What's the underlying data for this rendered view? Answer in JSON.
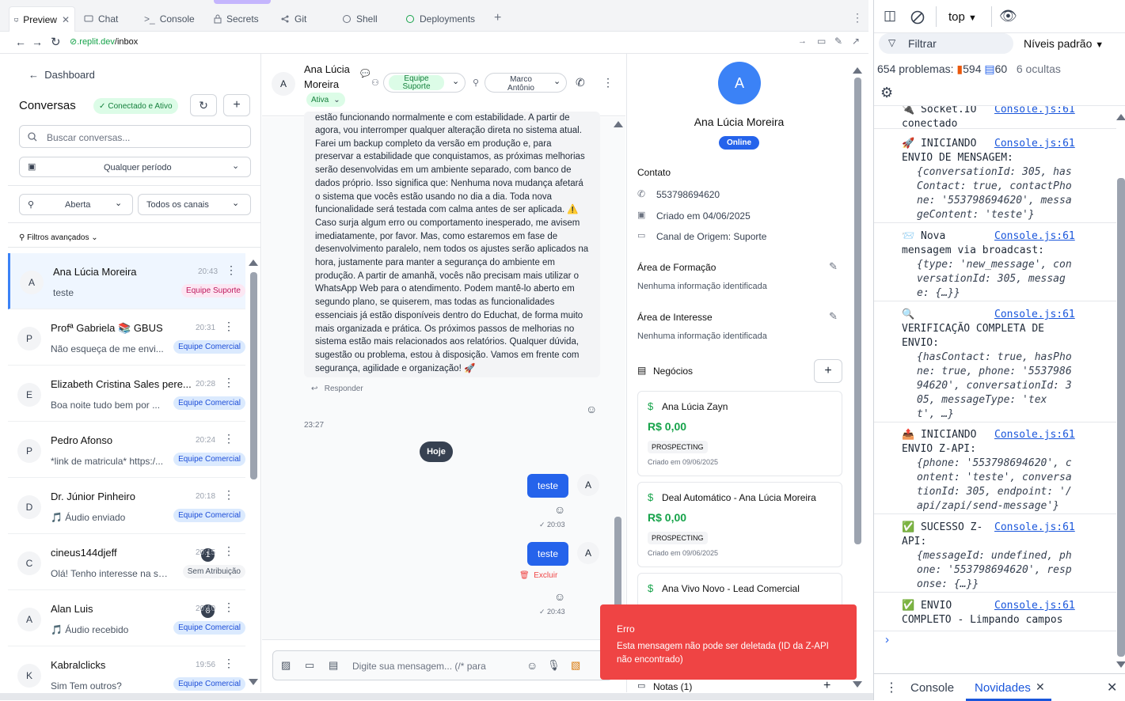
{
  "tabs": [
    {
      "label": "Preview"
    },
    {
      "label": "Chat"
    },
    {
      "label": "Console"
    },
    {
      "label": "Secrets"
    },
    {
      "label": "Git"
    },
    {
      "label": "Shell"
    },
    {
      "label": "Deployments"
    }
  ],
  "url": {
    "domain": ".replit.dev",
    "path": "/inbox"
  },
  "left": {
    "back": "Dashboard",
    "title": "Conversas",
    "status": "Conectado e Ativo",
    "search_placeholder": "Buscar conversas...",
    "period": "Qualquer período",
    "status_filter": "Aberta",
    "channel_filter": "Todos os canais",
    "advanced": "Filtros avançados",
    "conversations": [
      {
        "initial": "A",
        "name": "Ana Lúcia Moreira",
        "time": "20:43",
        "msg": "teste",
        "badge": "Equipe Suporte",
        "badge_color": "pink"
      },
      {
        "initial": "P",
        "name": "Profª Gabriela 📚 GBUS",
        "time": "20:31",
        "msg": "Não esqueça de me envi...",
        "badge": "Equipe Comercial",
        "badge_color": "blue"
      },
      {
        "initial": "E",
        "name": "Elizabeth Cristina Sales pere...",
        "time": "20:28",
        "msg": "Boa noite tudo bem por ...",
        "badge": "Equipe Comercial",
        "badge_color": "blue"
      },
      {
        "initial": "P",
        "name": "Pedro Afonso",
        "time": "20:24",
        "msg": "*link de matricula* https:/...",
        "badge": "Equipe Comercial",
        "badge_color": "blue"
      },
      {
        "initial": "D",
        "name": "Dr. Júnior Pinheiro",
        "time": "20:18",
        "msg": "🎵 Áudio enviado",
        "badge": "Equipe Comercial",
        "badge_color": "blue"
      },
      {
        "initial": "C",
        "name": "cineus144djeff",
        "time": "20:15",
        "msg": "Olá! Tenho interesse na seg...",
        "badge": "Sem Atribuição",
        "badge_color": "gray",
        "unread": "1"
      },
      {
        "initial": "A",
        "name": "Alan Luis",
        "time": "20:10",
        "msg": "🎵 Áudio recebido",
        "badge": "Equipe Comercial",
        "badge_color": "blue",
        "unread": "8"
      },
      {
        "initial": "K",
        "name": "Kabralclicks",
        "time": "19:56",
        "msg": "Sim Tem outros?",
        "badge": "Equipe Comercial",
        "badge_color": "blue"
      }
    ]
  },
  "chat": {
    "avatar": "A",
    "name_line1": "Ana Lúcia",
    "name_line2": "Moreira",
    "status": "Ativa",
    "team": "Equipe Suporte",
    "agent": "Marco Antônio",
    "message_top": "estão funcionando normalmente e com estabilidade. A partir de",
    "message_body": "agora, vou interromper qualquer alteração direta no sistema atual. Farei um backup completo da versão em produção e, para preservar a estabilidade que conquistamos, as próximas melhorias serão desenvolvidas em um ambiente separado, com banco de dados próprio. Isso significa que: Nenhuma nova mudança afetará o sistema que vocês estão usando no dia a dia. Toda nova funcionalidade será testada com calma antes de ser aplicada. ⚠️ Caso surja algum erro ou comportamento inesperado, me avisem imediatamente, por favor. Mas, como estaremos em fase de desenvolvimento paralelo, nem todos os ajustes serão aplicados na hora, justamente para manter a segurança do ambiente em produção. A partir de amanhã, vocês não precisam mais utilizar o WhatsApp Web para o atendimento. Podem mantê-lo aberto em segundo plano, se quiserem, mas todas as funcionalidades essenciais já estão disponíveis dentro do Educhat, de forma muito mais organizada e prática. Os próximos passos de melhorias no sistema estão mais relacionados aos relatórios. Qualquer dúvida, sugestão ou problema, estou à disposição. Vamos em frente com segurança, agilidade e organização! 🚀",
    "reply": "Responder",
    "time_in": "23:27",
    "day": "Hoje",
    "out1": {
      "text": "teste",
      "time": "20:03"
    },
    "out2": {
      "text": "teste",
      "time": "20:43",
      "delete": "Excluir"
    },
    "input_placeholder": "Digite sua mensagem... (/* para"
  },
  "info": {
    "avatar": "A",
    "name": "Ana Lúcia Moreira",
    "online": "Online",
    "contact_title": "Contato",
    "phone": "553798694620",
    "created": "Criado em 04/06/2025",
    "channel": "Canal de Origem: Suporte",
    "formacao_title": "Área de Formação",
    "formacao_value": "Nenhuma informação identificada",
    "interesse_title": "Área de Interesse",
    "interesse_value": "Nenhuma informação identificada",
    "negocios_title": "Negócios",
    "deals": [
      {
        "title": "Ana Lúcia Zayn",
        "value": "R$ 0,00",
        "stage": "PROSPECTING",
        "created": "Criado em 09/06/2025"
      },
      {
        "title": "Deal Automático - Ana Lúcia Moreira",
        "value": "R$ 0,00",
        "stage": "PROSPECTING",
        "created": "Criado em 09/06/2025"
      },
      {
        "title": "Ana Vivo Novo - Lead Comercial",
        "value": "",
        "stage": "",
        "created": ""
      }
    ],
    "notes": "Notas (1)"
  },
  "toast": {
    "title": "Erro",
    "message": "Esta mensagem não pode ser deletada (ID da Z-API não encontrado)"
  },
  "devtools": {
    "context": "top",
    "filter_placeholder": "Filtrar",
    "levels": "Níveis padrão",
    "problems": "654 problemas:",
    "errors": "594",
    "messages": "60",
    "hidden": "6 ocultas",
    "bottom_tab1": "Console",
    "bottom_tab2": "Novidades",
    "source": "Console.js:61",
    "logs": [
      {
        "head": "🔌 Socket.IO",
        "head2": "conectado"
      },
      {
        "head": "🚀 INICIANDO",
        "head2": "ENVIO DE MENSAGEM:"
      },
      {
        "head": "📨 Nova",
        "head2": "mensagem via broadcast:"
      },
      {
        "head": "🔍",
        "head2": "VERIFICAÇÃO COMPLETA DE ENVIO:"
      },
      {
        "head": "📤 INICIANDO",
        "head2": "ENVIO Z-API:"
      },
      {
        "head": "✅ SUCESSO Z-",
        "head2": "API:"
      },
      {
        "head": "✅ ENVIO",
        "head2": "COMPLETO - Limpando campos"
      }
    ],
    "obj1": [
      "{conversationId: 305, has",
      "Contact: true, contactPho",
      "ne: '553798694620', messa",
      "geContent: 'teste'}"
    ],
    "obj2": [
      "{type: 'new_message', con",
      "versationId: 305, messag",
      "e: {…}}"
    ],
    "obj3": [
      "{hasContact: true, hasPho",
      "ne: true, phone: '5537986",
      "94620', conversationId: 3",
      "05, messageType: 'tex",
      "t', …}"
    ],
    "obj4": [
      "{phone: '553798694620', c",
      "ontent: 'teste', conversa",
      "tionId: 305, endpoint: '/",
      "api/zapi/send-message'}"
    ],
    "obj5": [
      "{messageId: undefined, ph",
      "one: '553798694620', resp",
      "onse: {…}}"
    ]
  },
  "colors": {
    "accent": "#2563eb",
    "success": "#16a34a",
    "danger": "#ef4444",
    "badge_blue": "#dbeafe"
  }
}
